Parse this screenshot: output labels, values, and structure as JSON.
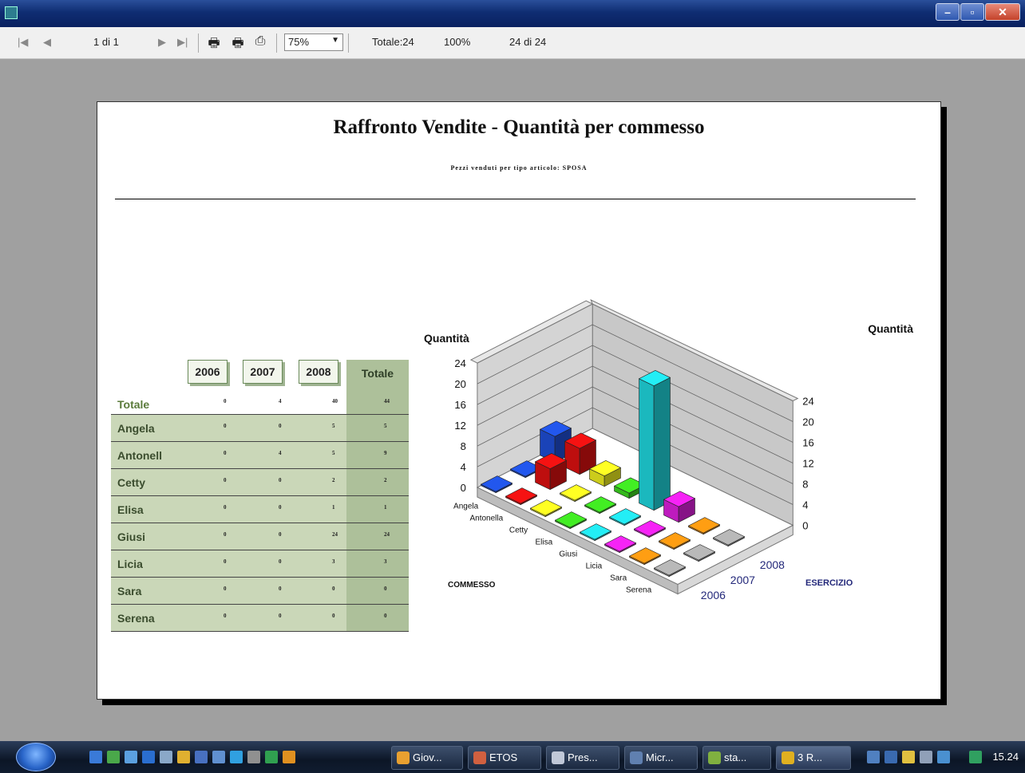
{
  "toolbar": {
    "page_indicator": "1 di 1",
    "zoom": "75%",
    "totale": "Totale:24",
    "percent": "100%",
    "records": "24 di 24"
  },
  "report": {
    "title": "Raffronto Vendite - Quantità per commesso",
    "subtitle": "Pezzi venduti per tipo articolo: SPOSA"
  },
  "table": {
    "years": [
      "2006",
      "2007",
      "2008"
    ],
    "totale_label": "Totale",
    "total_row": {
      "label": "Totale",
      "v2006": "0",
      "v2007": "4",
      "v2008": "40",
      "total": "44"
    },
    "rows": [
      {
        "label": "Angela",
        "v2006": "0",
        "v2007": "0",
        "v2008": "5",
        "total": "5"
      },
      {
        "label": "Antonell",
        "v2006": "0",
        "v2007": "4",
        "v2008": "5",
        "total": "9"
      },
      {
        "label": "Cetty",
        "v2006": "0",
        "v2007": "0",
        "v2008": "2",
        "total": "2"
      },
      {
        "label": "Elisa",
        "v2006": "0",
        "v2007": "0",
        "v2008": "1",
        "total": "1"
      },
      {
        "label": "Giusi",
        "v2006": "0",
        "v2007": "0",
        "v2008": "24",
        "total": "24"
      },
      {
        "label": "Licia",
        "v2006": "0",
        "v2007": "0",
        "v2008": "3",
        "total": "3"
      },
      {
        "label": "Sara",
        "v2006": "0",
        "v2007": "0",
        "v2008": "0",
        "total": "0"
      },
      {
        "label": "Serena",
        "v2006": "0",
        "v2007": "0",
        "v2008": "0",
        "total": "0"
      }
    ]
  },
  "chart_data": {
    "type": "bar",
    "title": "",
    "ylabel_left": "Quantità",
    "ylabel_right": "Quantità",
    "x_axis_label": "COMMESSO",
    "z_axis_label": "ESERCIZIO",
    "categories": [
      "Angela",
      "Antonella",
      "Cetty",
      "Elisa",
      "Giusi",
      "Licia",
      "Sara",
      "Serena"
    ],
    "yticks": [
      0,
      4,
      8,
      12,
      16,
      20,
      24
    ],
    "ylim": [
      0,
      24
    ],
    "series": [
      {
        "name": "2006",
        "values": [
          0,
          0,
          0,
          0,
          0,
          0,
          0,
          0
        ]
      },
      {
        "name": "2007",
        "values": [
          0,
          4,
          0,
          0,
          0,
          0,
          0,
          0
        ]
      },
      {
        "name": "2008",
        "values": [
          5,
          5,
          2,
          1,
          24,
          3,
          0,
          0
        ]
      }
    ],
    "colors": [
      "#1f4fd8",
      "#e01010",
      "#f0f020",
      "#3cd820",
      "#20d8e0",
      "#e020e0",
      "#f09010",
      "#a8a8a8"
    ]
  },
  "taskbar": {
    "tasks": [
      "Giov...",
      "ETOS",
      "Pres...",
      "Micr...",
      "sta...",
      "3 R..."
    ],
    "clock": "15.24"
  }
}
